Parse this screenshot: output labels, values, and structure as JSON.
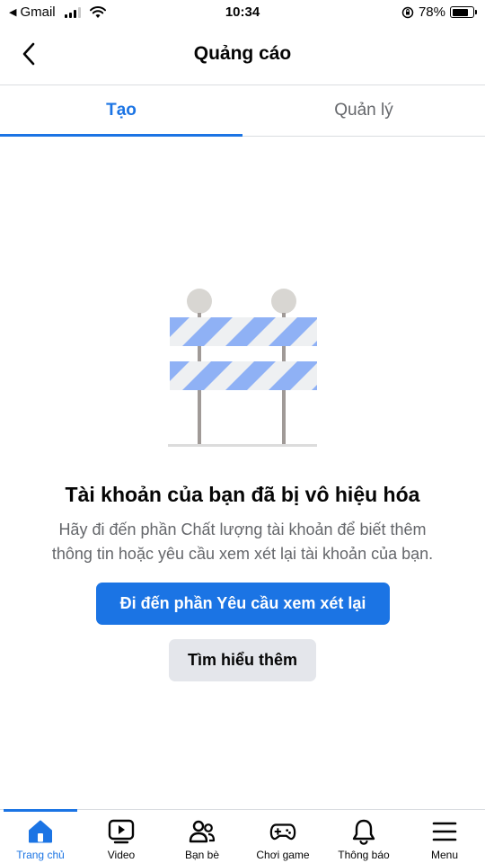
{
  "status_bar": {
    "back_app": "Gmail",
    "time": "10:34",
    "battery_percent": "78%",
    "battery_level": 0.78
  },
  "header": {
    "title": "Quảng cáo"
  },
  "tabs": [
    {
      "label": "Tạo",
      "active": true
    },
    {
      "label": "Quản lý",
      "active": false
    }
  ],
  "message": {
    "title": "Tài khoản của bạn đã bị vô hiệu hóa",
    "body_line1": "Hãy đi đến phần Chất lượng tài khoản để biết thêm",
    "body_line2": "thông tin hoặc yêu cầu xem xét lại tài khoản của bạn."
  },
  "actions": {
    "primary_label": "Đi đến phần Yêu cầu xem xét lại",
    "secondary_label": "Tìm hiểu thêm"
  },
  "bottom_nav": [
    {
      "label": "Trang chủ",
      "icon": "home-icon",
      "active": true
    },
    {
      "label": "Video",
      "icon": "video-icon",
      "active": false
    },
    {
      "label": "Bạn bè",
      "icon": "friends-icon",
      "active": false
    },
    {
      "label": "Chơi game",
      "icon": "gaming-icon",
      "active": false
    },
    {
      "label": "Thông báo",
      "icon": "bell-icon",
      "active": false
    },
    {
      "label": "Menu",
      "icon": "menu-icon",
      "active": false
    }
  ],
  "colors": {
    "accent": "#1b74e4",
    "secondary_text": "#65676b",
    "secondary_button": "#e4e6eb",
    "barrier_stripe": "#8fb1f5",
    "barrier_light": "#eef0f2",
    "barrier_lamp": "#d8d6d2",
    "barrier_post": "#a09a97"
  }
}
